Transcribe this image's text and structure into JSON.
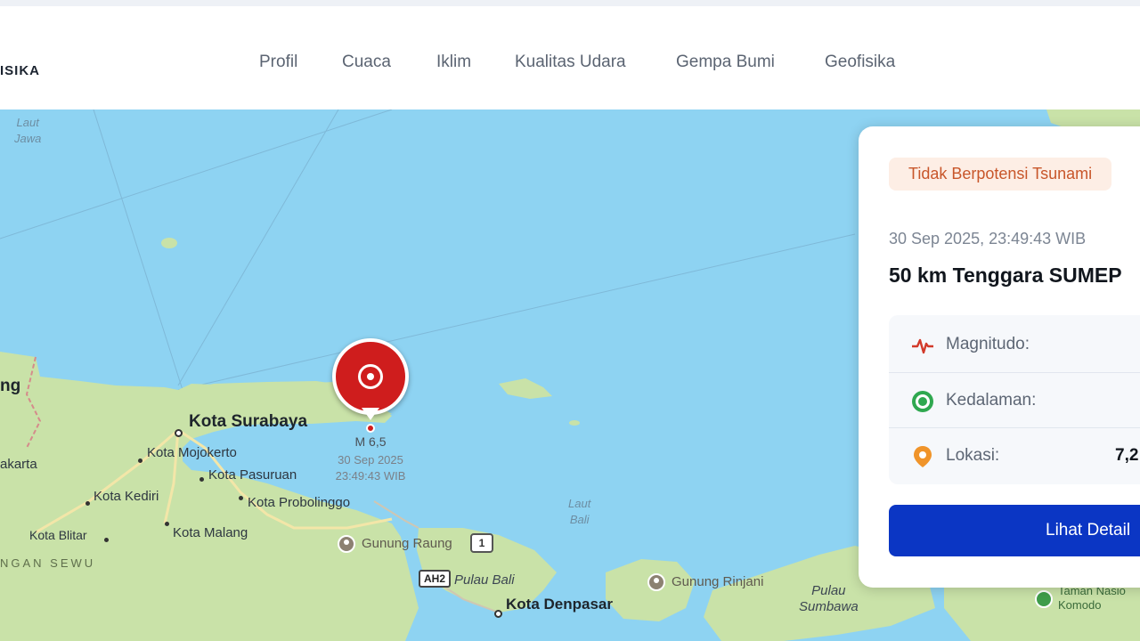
{
  "brand": {
    "text": "ISIKA"
  },
  "nav": {
    "items": [
      {
        "label": "Profil"
      },
      {
        "label": "Cuaca"
      },
      {
        "label": "Iklim"
      },
      {
        "label": "Kualitas Udara"
      },
      {
        "label": "Gempa Bumi"
      },
      {
        "label": "Geofisika"
      }
    ]
  },
  "map": {
    "seas": {
      "laut_jawa": "Laut\nJawa",
      "laut_bali": "Laut\nBali"
    },
    "cities": {
      "surabaya": "Kota Surabaya",
      "mojokerto": "Kota Mojokerto",
      "pasuruan": "Kota Pasuruan",
      "probolinggo": "Kota Probolinggo",
      "kediri": "Kota Kediri",
      "malang": "Kota Malang",
      "blitar": "Kota Blitar",
      "denpasar": "Kota Denpasar"
    },
    "partial": {
      "ng": "ng",
      "akarta": "akarta",
      "sewu": "NGAN SEWU"
    },
    "peaks": {
      "raung": "Gunung Raung",
      "rinjani": "Gunung Rinjani"
    },
    "islands": {
      "bali": "Pulau Bali",
      "sumbawa": "Pulau\nSumbawa"
    },
    "parks": {
      "komodo": "Taman Nasio\nKomodo"
    },
    "shields": {
      "route1": "1",
      "ah2": "AH2"
    },
    "epicenter": {
      "magnitude": "M 6,5",
      "date": "30 Sep 2025",
      "time": "23:49:43 WIB"
    }
  },
  "panel": {
    "badge": "Tidak Berpotensi Tsunami",
    "datetime": "30 Sep 2025, 23:49:43 WIB",
    "location": "50 km Tenggara SUMEP",
    "rows": [
      {
        "label": "Magnitudo:",
        "value": "",
        "icon": "pulse-icon"
      },
      {
        "label": "Kedalaman:",
        "value": "",
        "icon": "target-icon"
      },
      {
        "label": "Lokasi:",
        "value": "7,2",
        "icon": "map-pin-icon"
      }
    ],
    "button": "Lihat Detail"
  },
  "colors": {
    "sea": "#8ed3f2",
    "land": "#c9e2a8",
    "accent": "#0b36c4",
    "epicenter": "#cf1d1d",
    "badge_bg": "#fdeee5",
    "badge_text": "#c8562a"
  }
}
